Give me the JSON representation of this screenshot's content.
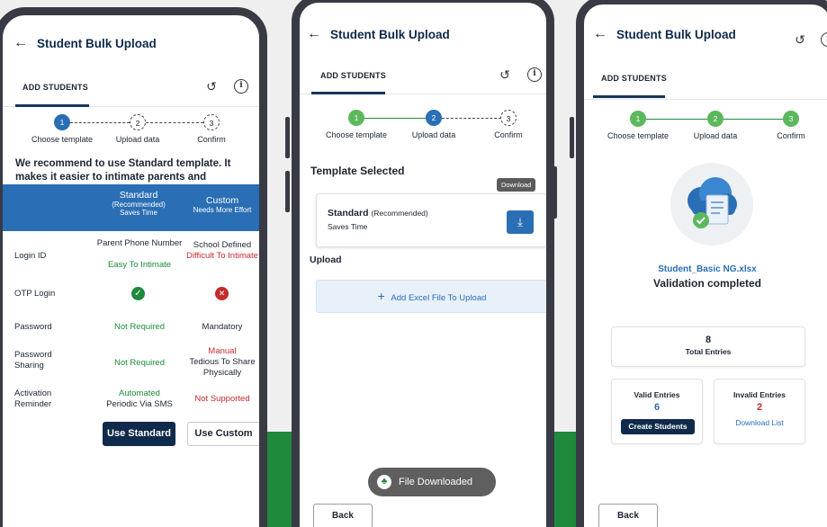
{
  "colors": {
    "primary": "#0f2a4a",
    "accent_blue": "#2a6eb5",
    "green": "#1f8a3c",
    "red": "#c42b2b"
  },
  "common": {
    "title": "Student Bulk Upload",
    "tab": "ADD STUDENTS",
    "icons": {
      "back": "back-arrow-icon",
      "history": "history-icon",
      "info": "info-icon"
    },
    "steps": [
      {
        "num": "1",
        "label": "Choose template"
      },
      {
        "num": "2",
        "label": "Upload data"
      },
      {
        "num": "3",
        "label": "Confirm"
      }
    ]
  },
  "screen1": {
    "recommendation": "We recommend to use Standard template. It makes it easier to intimate parents and automates your work.",
    "columns": {
      "standard": {
        "title": "Standard",
        "sub": "(Recommended)",
        "note": "Saves Time"
      },
      "custom": {
        "title": "Custom",
        "note": "Needs More Effort"
      }
    },
    "rows": [
      {
        "label": "Login ID",
        "standard": "Parent Phone Number",
        "standard_note": "Easy To Intimate",
        "custom": "School Defined",
        "custom_note": "Difficult To Intimate"
      },
      {
        "label": "OTP Login",
        "standard_icon": "check-icon",
        "custom_icon": "cross-icon"
      },
      {
        "label": "Password",
        "standard": "Not Required",
        "custom": "Mandatory"
      },
      {
        "label": "Password Sharing",
        "standard": "Not Required",
        "custom_note": "Manual",
        "custom": "Tedious To Share Physically"
      },
      {
        "label": "Activation Reminder",
        "standard_note": "Automated",
        "standard": "Periodic Via SMS",
        "custom": "Not Supported"
      }
    ],
    "btn_standard": "Use Standard",
    "btn_custom": "Use Custom"
  },
  "screen2": {
    "template_heading": "Template Selected",
    "template_name": "Standard",
    "template_tag": "(Recommended)",
    "template_sub": "Saves Time",
    "download_tooltip": "Download",
    "upload_heading": "Upload",
    "upload_cta": "Add Excel File To Upload",
    "toast": "File Downloaded",
    "back": "Back"
  },
  "screen3": {
    "file_name": "Student_Basic NG.xlsx",
    "status": "Validation completed",
    "total_value": "8",
    "total_label": "Total Entries",
    "valid_label": "Valid Entries",
    "valid_value": "6",
    "create_btn": "Create Students",
    "invalid_label": "Invalid Entries",
    "invalid_value": "2",
    "download_list": "Download List",
    "back": "Back"
  }
}
